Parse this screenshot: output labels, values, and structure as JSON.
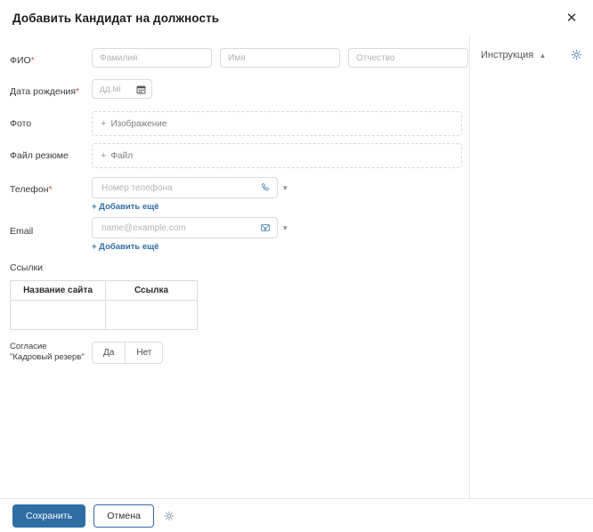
{
  "header": {
    "title": "Добавить Кандидат на должность",
    "close_icon": "close-icon"
  },
  "form": {
    "fio": {
      "label": "ФИО",
      "required": "*",
      "surname_placeholder": "Фамилия",
      "firstname_placeholder": "Имя",
      "patronymic_placeholder": "Отчество"
    },
    "birthdate": {
      "label": "Дата рождения",
      "required": "*",
      "placeholder": "дд.мі",
      "icon": "calendar-icon"
    },
    "photo": {
      "label": "Фото",
      "dropzone_label": "Изображение",
      "plus": "+"
    },
    "resume": {
      "label": "Файл резюме",
      "dropzone_label": "Файл",
      "plus": "+"
    },
    "phone": {
      "label": "Телефон",
      "required": "*",
      "placeholder": "Номер телефона",
      "icon": "phone-icon",
      "add_more": "+ Добавить ещё"
    },
    "email": {
      "label": "Email",
      "placeholder": "name@example.com",
      "icon": "envelope-icon",
      "add_more": "+ Добавить ещё"
    },
    "links": {
      "label": "Ссылки",
      "columns": [
        "Название сайта",
        "Ссылка"
      ],
      "rows": [
        [
          "",
          ""
        ]
      ]
    },
    "reserve": {
      "label": "Согласие \"Кадровый резерв\"",
      "options": [
        "Да",
        "Нет"
      ]
    }
  },
  "instruction": {
    "label": "Инструкция",
    "collapse_icon": "chevron-up-icon",
    "settings_icon": "gear-icon"
  },
  "footer": {
    "save_label": "Сохранить",
    "cancel_label": "Отмена",
    "settings_icon": "gear-icon"
  },
  "colors": {
    "primary": "#2f6ea5",
    "required": "#d64545",
    "border": "#dadada",
    "placeholder": "#b4b4b4"
  }
}
